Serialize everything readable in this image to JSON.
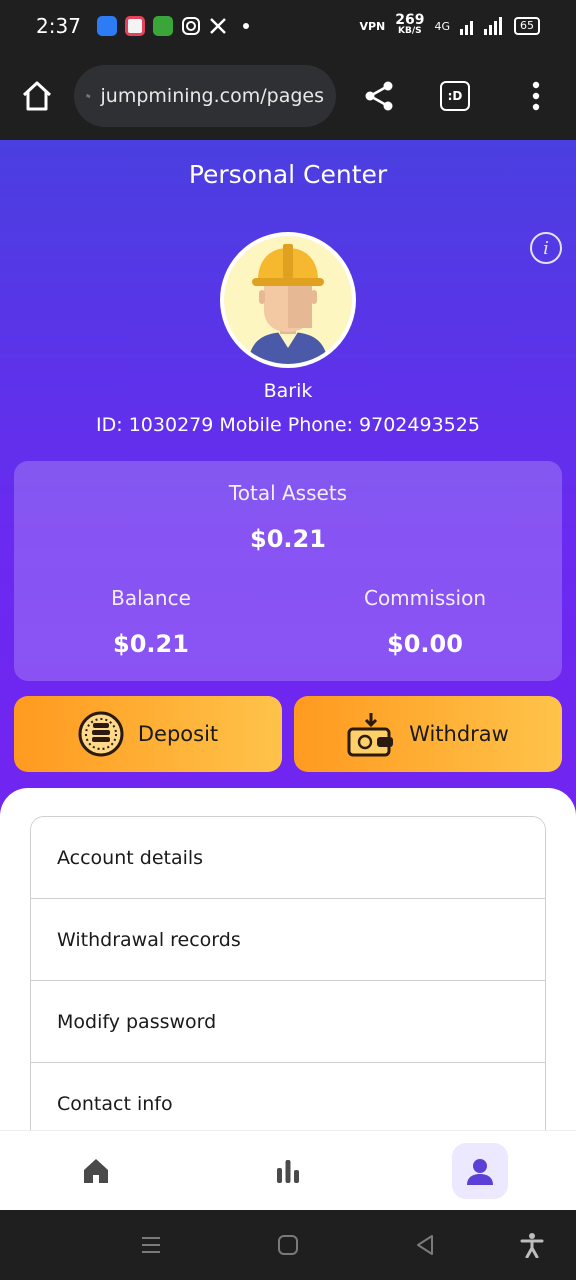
{
  "status_bar": {
    "time": "2:37",
    "speed_value": "269",
    "speed_unit": "KB/S",
    "vpn": "VPN",
    "network": "4G",
    "battery": "65"
  },
  "browser": {
    "url": "jumpmining.com/pages",
    "tab_label": ":D"
  },
  "profile": {
    "title": "Personal Center",
    "username": "Barik",
    "id_line": "ID: 1030279   Mobile Phone: 9702493525"
  },
  "assets": {
    "total_label": "Total Assets",
    "total_value": "$0.21",
    "balance_label": "Balance",
    "balance_value": "$0.21",
    "commission_label": "Commission",
    "commission_value": "$0.00"
  },
  "actions": {
    "deposit_label": "Deposit",
    "withdraw_label": "Withdraw"
  },
  "menu": {
    "items": [
      {
        "label": "Account details"
      },
      {
        "label": "Withdrawal records"
      },
      {
        "label": "Modify password"
      },
      {
        "label": "Contact info"
      }
    ]
  },
  "nav": {
    "items": [
      "home-icon",
      "chart-icon",
      "user-icon"
    ],
    "active": "user-icon",
    "accent": "#5b3fd6"
  }
}
